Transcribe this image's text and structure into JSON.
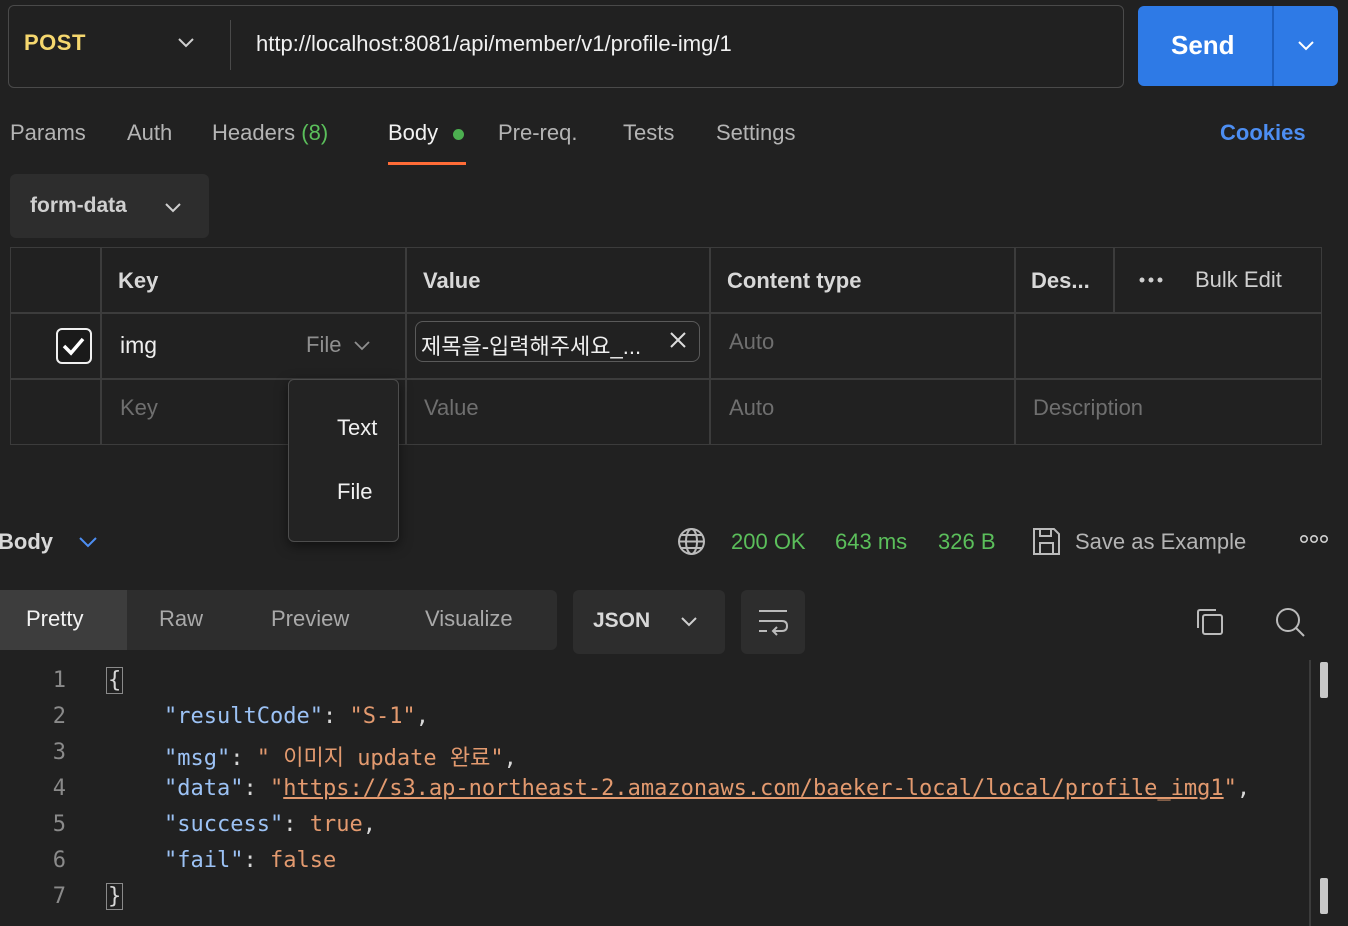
{
  "request": {
    "method": "POST",
    "url": "http://localhost:8081/api/member/v1/profile-img/1",
    "send_label": "Send"
  },
  "tabs": {
    "params": "Params",
    "auth": "Auth",
    "headers": "Headers",
    "headers_count": "(8)",
    "body": "Body",
    "prereq": "Pre-req.",
    "tests": "Tests",
    "settings": "Settings",
    "cookies": "Cookies"
  },
  "body_type": "form-data",
  "table": {
    "headers": {
      "key": "Key",
      "value": "Value",
      "content_type": "Content type",
      "description": "Des...",
      "bulk_edit": "Bulk Edit"
    },
    "rows": [
      {
        "checked": true,
        "key": "img",
        "type": "File",
        "value": "제목을-입력해주세요_...",
        "content_type": "Auto"
      }
    ],
    "placeholder": {
      "key": "Key",
      "value": "Value",
      "content_type": "Auto",
      "description": "Description"
    }
  },
  "type_dropdown": {
    "options": [
      "Text",
      "File"
    ]
  },
  "response": {
    "label": "Body",
    "status": "200 OK",
    "time": "643 ms",
    "size": "326 B",
    "save_example": "Save as Example",
    "view_tabs": [
      "Pretty",
      "Raw",
      "Preview",
      "Visualize"
    ],
    "format": "JSON",
    "lines": [
      "1",
      "2",
      "3",
      "4",
      "5",
      "6",
      "7"
    ],
    "json": {
      "open": "{",
      "k1": "\"resultCode\"",
      "v1": "\"S-1\"",
      "k2": "\"msg\"",
      "v2": "\" 이미지 update 완료\"",
      "k3": "\"data\"",
      "v3_q1": "\"",
      "v3": "https://s3.ap-northeast-2.amazonaws.com/baeker-local/local/profile_img1",
      "v3_q2": "\"",
      "k4": "\"success\"",
      "v4": "true",
      "k5": "\"fail\"",
      "v5": "false",
      "close": "}"
    }
  },
  "colors": {
    "accent": "#2e7ae6",
    "method": "#f5d76e",
    "status": "#5bbf5b",
    "tab_underline": "#ff6c37"
  }
}
